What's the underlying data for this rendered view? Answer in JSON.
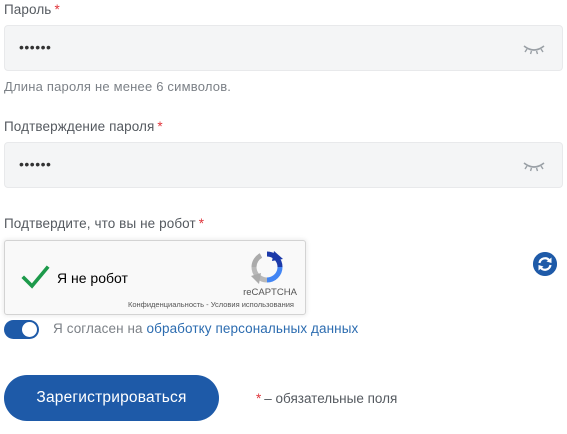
{
  "password": {
    "label": "Пароль",
    "required_mark": "*",
    "value": "••••••",
    "hint": "Длина пароля не менее 6 символов."
  },
  "confirm": {
    "label": "Подтверждение пароля",
    "required_mark": "*",
    "value": "••••••"
  },
  "captcha": {
    "label": "Подтвердите, что вы не робот",
    "required_mark": "*",
    "checkbox_label": "Я не робот",
    "brand": "reCAPTCHA",
    "privacy": "Конфиденциальность",
    "separator": " - ",
    "terms": "Условия использования",
    "checked": true
  },
  "consent": {
    "prefix": "Я согласен на ",
    "link": "обработку персональных данных",
    "enabled": true
  },
  "submit_label": "Зарегистрироваться",
  "legend": {
    "mark": "*",
    "text": "– обязательные поля"
  },
  "colors": {
    "accent": "#1e5aa8",
    "required": "#e0353b",
    "link": "#2c6cb0",
    "check": "#1d9a4b"
  },
  "icons": {
    "eye": "eye-closed-icon",
    "check": "checkmark-icon",
    "recaptcha": "recaptcha-logo",
    "refresh": "refresh-icon"
  }
}
